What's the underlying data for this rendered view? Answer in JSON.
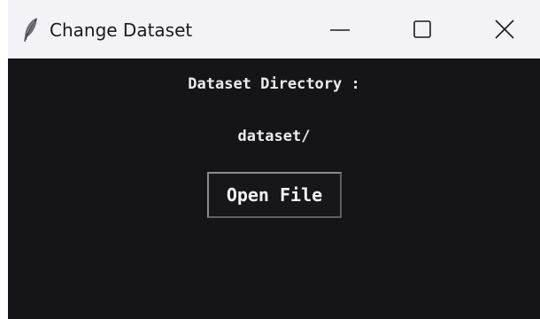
{
  "window": {
    "title": "Change Dataset",
    "icon": "feather-icon",
    "controls": [
      "minimize-icon",
      "maximize-icon",
      "close-icon"
    ]
  },
  "content": {
    "heading": "Dataset Directory :",
    "path_value": "dataset/",
    "open_button_label": "Open File"
  },
  "colors": {
    "titlebar_bg": "#f3f2f7",
    "window_bg": "#151419",
    "text": "#ececec"
  }
}
